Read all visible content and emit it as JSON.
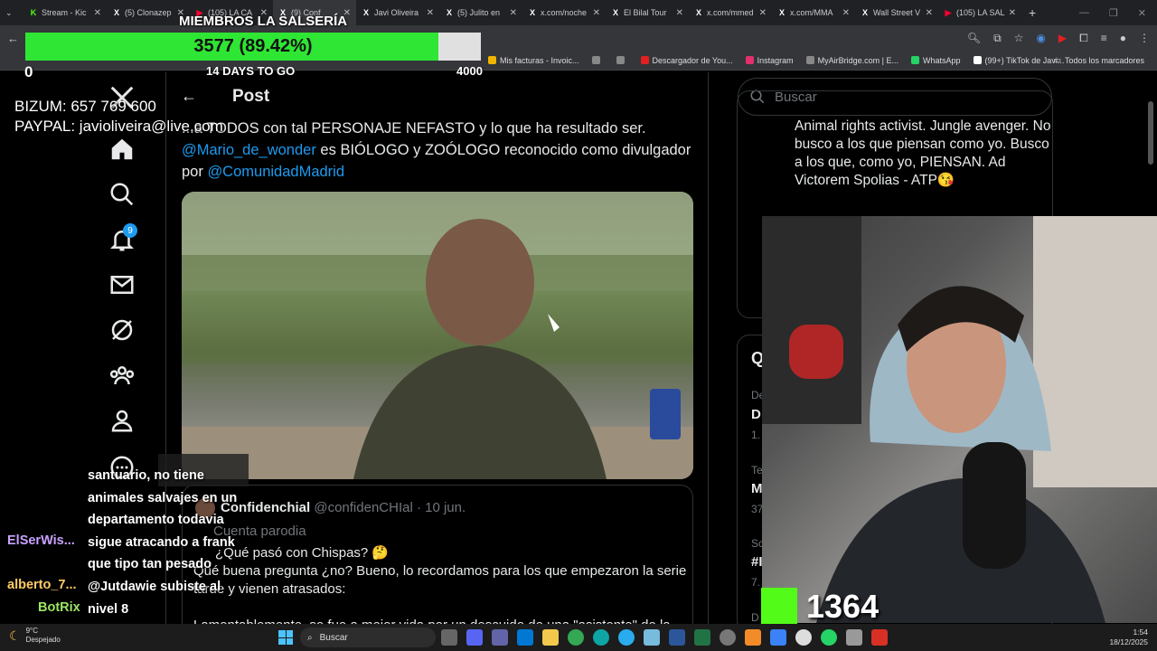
{
  "browser": {
    "tabs": [
      {
        "title": "Stream - Kic",
        "fav": "K",
        "color": "#53fc18"
      },
      {
        "title": "(5) Clonazep",
        "fav": "X",
        "color": "#ffffff"
      },
      {
        "title": "(105) LA CA",
        "fav": "▶",
        "color": "#ff0033"
      },
      {
        "title": "(9) Conf",
        "fav": "X",
        "color": "#ffffff"
      },
      {
        "title": "Javi Oliveira",
        "fav": "X",
        "color": "#ffffff"
      },
      {
        "title": "(5) Julito en",
        "fav": "X",
        "color": "#ffffff"
      },
      {
        "title": "x.com/noche",
        "fav": "X",
        "color": "#ffffff"
      },
      {
        "title": "El Bilal Tour",
        "fav": "X",
        "color": "#ffffff"
      },
      {
        "title": "x.com/mmed",
        "fav": "X",
        "color": "#ffffff"
      },
      {
        "title": "x.com/MMA",
        "fav": "X",
        "color": "#ffffff"
      },
      {
        "title": "Wall Street V",
        "fav": "X",
        "color": "#ffffff"
      },
      {
        "title": "(105) LA SAL",
        "fav": "▶",
        "color": "#ff0033"
      }
    ],
    "bookmarks": [
      {
        "label": "Mis facturas - Invoic...",
        "color": "#f0b400"
      },
      {
        "label": "",
        "color": "#888888"
      },
      {
        "label": "",
        "color": "#888888"
      },
      {
        "label": "Descargador de You...",
        "color": "#e02020"
      },
      {
        "label": "Instagram",
        "color": "#e1306c"
      },
      {
        "label": "MyAirBridge.com | E...",
        "color": "#888888"
      },
      {
        "label": "WhatsApp",
        "color": "#25d366"
      },
      {
        "label": "(99+) TikTok de Javi...",
        "color": "#ffffff"
      }
    ],
    "bookmarks_right": "Todos los marcadores"
  },
  "overlay": {
    "goal_title": "MIEMBROS LA SALSERÍA",
    "goal_text": "3577 (89.42%)",
    "goal_fraction": 0.9075,
    "goal_min": "0",
    "goal_days": "14 DAYS TO GO",
    "goal_max": "4000",
    "bizum": "BIZUM: 657 769 600",
    "paypal": "PAYPAL: javioliveira@live.com"
  },
  "x": {
    "notification_count": "9",
    "post_header": "Post",
    "post_text_line1": "...a TODOS con tal PERSONAJE NEFASTO y lo que ha resultado ser.",
    "mention1": "@Mario_de_wonder",
    "post_text_mid": " es BIÓLOGO y ZOÓLOGO reconocido como divulgador",
    "post_text_por": "por ",
    "mention2": "@ComunidadMadrid",
    "quote": {
      "name": "Confidenchial",
      "handle": "@confidenCHIal · 10 jun.",
      "badge": "Cuenta parodia",
      "line1": "¿Qué pasó con Chispas? 🤔",
      "line2": "Qué buena pregunta ¿no? Bueno, lo recordamos para los que empezaron la serie",
      "line3": "tarde y vienen atrasados:",
      "line4": "Lamentablemente, se fue a mejor vida por un descuido de una \"asistente\" de la"
    },
    "search_placeholder": "Buscar",
    "bio": "Animal rights activist. Jungle avenger. No busco a los que piensan como yo. Busco a los que, como yo, PIENSAN. Ad Victorem Spolias - ATP😘",
    "side_q": "Q",
    "side_frags": [
      "De",
      "D",
      "1.",
      "Te",
      "M",
      "37",
      "Sc",
      "#I",
      "7.",
      "D"
    ]
  },
  "kick_viewers": "1364",
  "chat": {
    "message": "santuario, no tiene animales salvajes en un departamento todavia sigue atracando a frank que tipo tan pesado @Jutdawie subiste al nivel 8",
    "users": [
      {
        "name": "ElSerWis...",
        "color": "#c9a2ff"
      },
      {
        "name": "alberto_7...",
        "color": "#ffcc66"
      },
      {
        "name": "BotRix",
        "color": "#9be564"
      }
    ]
  },
  "taskbar": {
    "temp": "9°C",
    "weather": "Despejado",
    "search": "Buscar",
    "time": "1:54",
    "date": "18/12/2025"
  }
}
